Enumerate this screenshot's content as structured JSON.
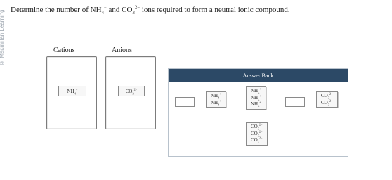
{
  "watermark": "© Macmillan Learning",
  "question": {
    "pre": "Determine the number of NH",
    "nh4_sub": "4",
    "nh4_sup": "+",
    "mid": " and CO",
    "co3_sub": "3",
    "co3_sup": "2−",
    "post": " ions required to form a neutral ionic compound."
  },
  "cations": {
    "label": "Cations",
    "placed": [
      {
        "base": "NH",
        "sub": "4",
        "sup": "+"
      }
    ]
  },
  "anions": {
    "label": "Anions",
    "placed": [
      {
        "base": "CO",
        "sub": "3",
        "sup": "2−"
      }
    ]
  },
  "answer_bank": {
    "title": "Answer Bank",
    "stack_nh4_x2": [
      {
        "base": "NH",
        "sub": "4",
        "sup": "+"
      },
      {
        "base": "NH",
        "sub": "4",
        "sup": "+"
      }
    ],
    "stack_nh4_x3": [
      {
        "base": "NH",
        "sub": "4",
        "sup": "+"
      },
      {
        "base": "NH",
        "sub": "4",
        "sup": "+"
      },
      {
        "base": "NH",
        "sub": "4",
        "sup": "+"
      }
    ],
    "stack_co3_x2": [
      {
        "base": "CO",
        "sub": "3",
        "sup": "2−"
      },
      {
        "base": "CO",
        "sub": "3",
        "sup": "2−"
      }
    ],
    "stack_co3_x3": [
      {
        "base": "CO",
        "sub": "3",
        "sup": "2−"
      },
      {
        "base": "CO",
        "sub": "3",
        "sup": "2−"
      },
      {
        "base": "CO",
        "sub": "3",
        "sup": "2−"
      }
    ]
  }
}
